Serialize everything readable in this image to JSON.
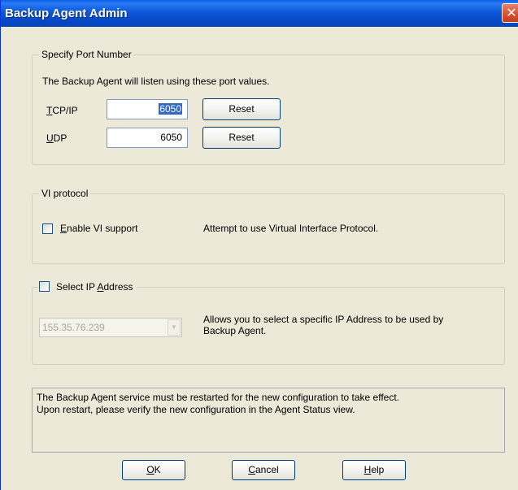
{
  "window": {
    "title": "Backup Agent Admin",
    "close_glyph": "✕",
    "close_icon": "close-icon"
  },
  "port_group": {
    "legend": "Specify Port Number",
    "description": "The Backup Agent will listen using these port values.",
    "tcp": {
      "label_mnemonic": "T",
      "label_rest": "CP/IP",
      "value": "6050",
      "reset_label": "Reset"
    },
    "udp": {
      "label_mnemonic": "U",
      "label_rest": "DP",
      "value": "6050",
      "reset_label": "Reset"
    }
  },
  "vi_group": {
    "legend": "VI protocol",
    "checkbox_mnemonic": "E",
    "checkbox_rest": "nable VI support",
    "checked": false,
    "description": "Attempt to use Virtual Interface Protocol."
  },
  "ip_group": {
    "checkbox_label_prefix": "Select IP ",
    "checkbox_mnemonic": "A",
    "checkbox_label_suffix": "ddress",
    "checked": false,
    "selected_ip": "155.35.76.239",
    "dropdown_icon": "chevron-down-icon",
    "description_line1": "Allows you to select a specific IP Address to be used by",
    "description_line2": "Backup Agent."
  },
  "status": {
    "line1": "The Backup Agent service must be restarted for the new configuration to take effect.",
    "line2": "Upon restart,  please verify the new configuration in the Agent Status view."
  },
  "buttons": {
    "ok_mnemonic": "O",
    "ok_rest": "K",
    "cancel_mnemonic": "C",
    "cancel_rest": "ancel",
    "help_mnemonic": "H",
    "help_rest": "elp"
  },
  "colors": {
    "titlebar": "#0a5fe6",
    "dialog_bg": "#ece9d8",
    "selection": "#316ac5",
    "close_button": "#d9502a"
  }
}
